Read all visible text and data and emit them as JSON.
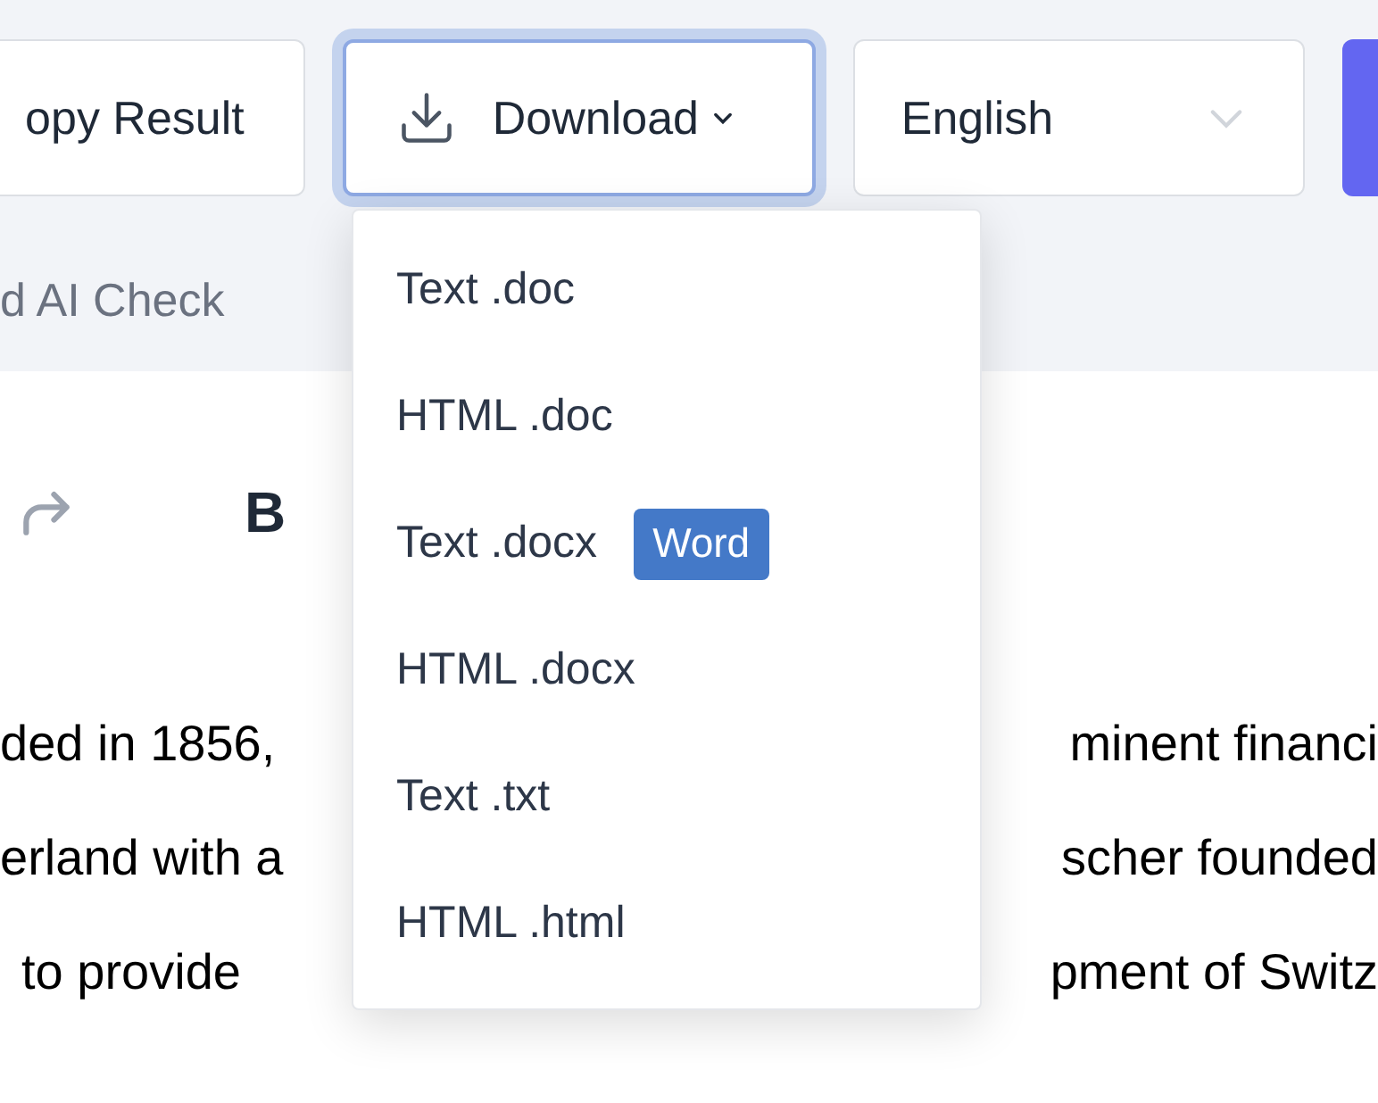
{
  "toolbar": {
    "copy_button": {
      "label": "opy Result"
    },
    "download_button": {
      "label": "Download",
      "expanded": true
    },
    "language_select": {
      "value": "English"
    },
    "ai_check": {
      "label": "d AI Check"
    }
  },
  "download_menu": [
    {
      "label": "Text .doc"
    },
    {
      "label": "HTML .doc"
    },
    {
      "label": "Text .docx",
      "badge": "Word"
    },
    {
      "label": "HTML .docx"
    },
    {
      "label": "Text .txt"
    },
    {
      "label": "HTML .html"
    }
  ],
  "editor": {
    "bold_button": "B",
    "lines": [
      {
        "left": "ded in 1856,",
        "right": "minent financi"
      },
      {
        "left": "erland with a",
        "right": "scher founded"
      },
      {
        "left": "to provide",
        "right": "pment of Switz"
      }
    ]
  }
}
